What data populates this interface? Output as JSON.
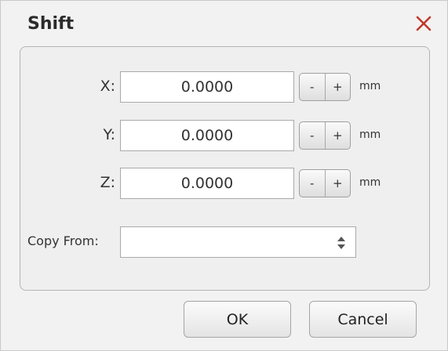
{
  "dialog": {
    "title": "Shift",
    "close_icon": "close-icon",
    "accent_color": "#c0392b"
  },
  "fields": [
    {
      "label": "X:",
      "value": "0.0000",
      "minus": "-",
      "plus": "+",
      "unit": "mm"
    },
    {
      "label": "Y:",
      "value": "0.0000",
      "minus": "-",
      "plus": "+",
      "unit": "mm"
    },
    {
      "label": "Z:",
      "value": "0.0000",
      "minus": "-",
      "plus": "+",
      "unit": "mm"
    }
  ],
  "copy_from": {
    "label": "Copy From:",
    "value": "",
    "icon": "updown-arrows-icon"
  },
  "buttons": {
    "ok": "OK",
    "cancel": "Cancel"
  }
}
